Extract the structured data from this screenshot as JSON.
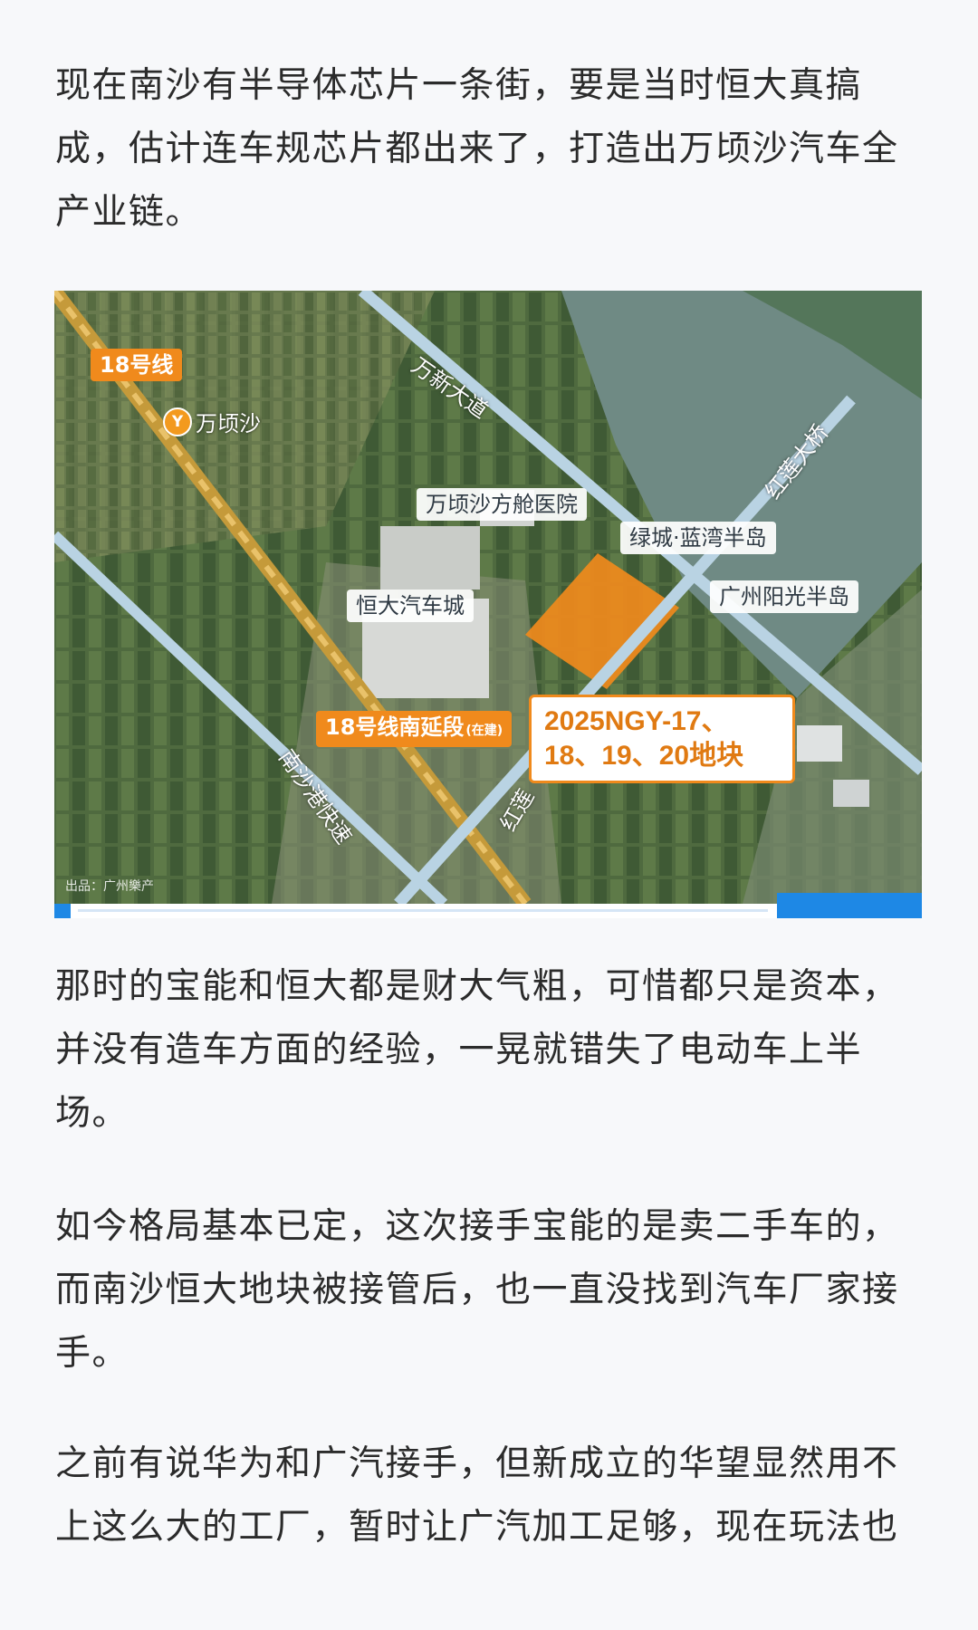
{
  "article": {
    "paragraphs": [
      "现在南沙有半导体芯片一条街，要是当时恒大真搞成，估计连车规芯片都出来了，打造出万顷沙汽车全产业链。",
      "那时的宝能和恒大都是财大气粗，可惜都只是资本，并没有造车方面的经验，一晃就错失了电动车上半场。",
      "如今格局基本已定，这次接手宝能的是卖二手车的，而南沙恒大地块被接管后，也一直没找到汽车厂家接手。",
      "之前有说华为和广汽接手，但新成立的华望显然用不上这么大的工厂，暂时让广汽加工足够，现在玩法也"
    ]
  },
  "map": {
    "line18": "18号线",
    "station": "万顷沙",
    "station_icon": "metro-icon",
    "road_wanxin": "万新大道",
    "hospital": "万顷沙方舱医院",
    "lvcheng": "绿城·蓝湾半岛",
    "evergrande": "恒大汽车城",
    "sunshine": "广州阳光半岛",
    "hongliang_bridge": "红莲大桥",
    "extension": "18号线南延段",
    "extension_tag": "(在建)",
    "expressway": "南沙港快速",
    "road_hong": "红莲",
    "plot_line1": "2025NGY-17、",
    "plot_line2": "18、19、20地块",
    "source": "出品：广州樂产",
    "colors": {
      "highlight": "#f08a1c",
      "water": "#6f8a84",
      "road": "#b9d3e3"
    }
  }
}
